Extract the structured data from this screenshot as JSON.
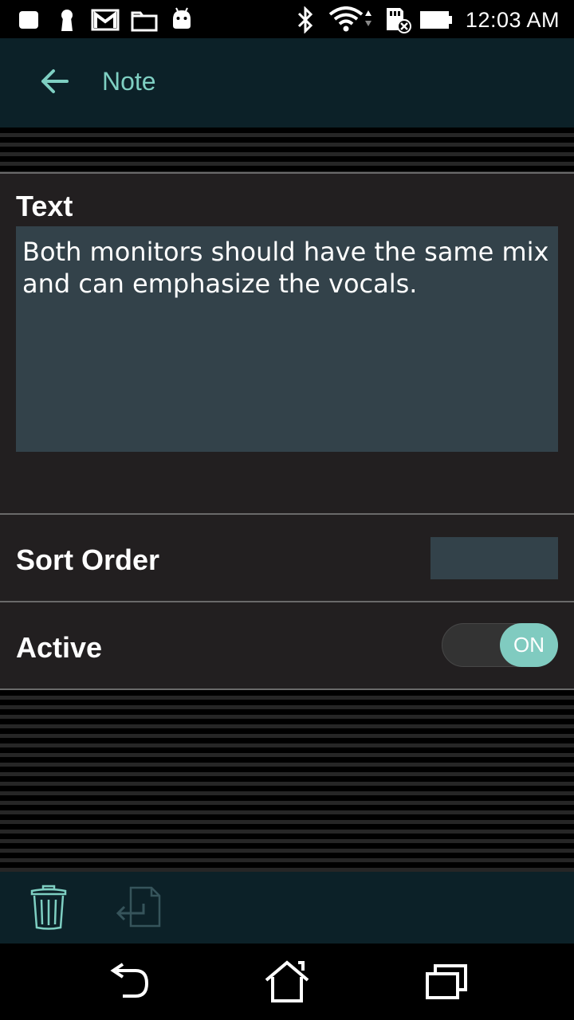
{
  "status_bar": {
    "time": "12:03 AM",
    "icons": [
      "notification-icon",
      "keyhole-icon",
      "gmail-icon",
      "folder-icon",
      "android-icon",
      "bluetooth-icon",
      "wifi-icon",
      "sd-card-icon",
      "battery-icon"
    ]
  },
  "app_bar": {
    "title": "Note",
    "back_icon": "arrow-left-icon"
  },
  "form": {
    "text_label": "Text",
    "text_value": "Both monitors should have the same mix and can emphasize the vocals.",
    "sort_order_label": "Sort Order",
    "sort_order_value": "",
    "active_label": "Active",
    "active_state": "ON"
  },
  "action_bar": {
    "icons": [
      "trash-icon",
      "export-icon"
    ]
  },
  "nav_bar": {
    "icons": [
      "back-icon",
      "home-icon",
      "recent-apps-icon"
    ]
  },
  "colors": {
    "accent": "#7ecfc2",
    "app_bar": "#0c2128",
    "panel": "#221f20",
    "input": "#33424a"
  }
}
